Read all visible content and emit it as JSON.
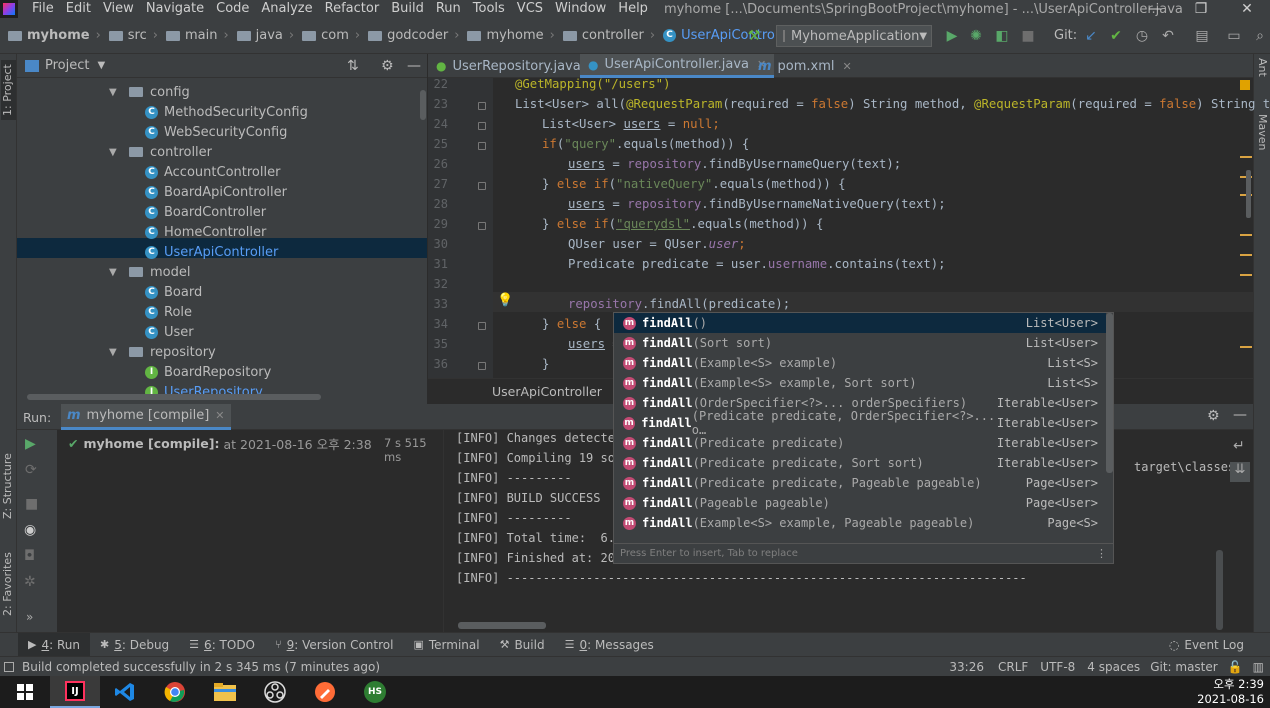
{
  "window": {
    "title": "myhome [...\\Documents\\SpringBootProject\\myhome] - ...\\UserApiController.java",
    "controls": [
      "—",
      "❐",
      "✕"
    ]
  },
  "menu": [
    "File",
    "Edit",
    "View",
    "Navigate",
    "Code",
    "Analyze",
    "Refactor",
    "Build",
    "Run",
    "Tools",
    "VCS",
    "Window",
    "Help"
  ],
  "breadcrumb": [
    "myhome",
    "src",
    "main",
    "java",
    "com",
    "godcoder",
    "myhome",
    "controller",
    "UserApiController"
  ],
  "run_config": "MyhomeApplication",
  "git_label": "Git:",
  "project_panel": {
    "title": "Project",
    "tree": [
      {
        "label": "config",
        "type": "folder",
        "open": true,
        "level": 1
      },
      {
        "label": "MethodSecurityConfig",
        "type": "class",
        "level": 2
      },
      {
        "label": "WebSecurityConfig",
        "type": "class",
        "level": 2
      },
      {
        "label": "controller",
        "type": "folder",
        "open": true,
        "level": 1
      },
      {
        "label": "AccountController",
        "type": "class",
        "level": 2
      },
      {
        "label": "BoardApiController",
        "type": "class",
        "level": 2
      },
      {
        "label": "BoardController",
        "type": "class",
        "level": 2
      },
      {
        "label": "HomeController",
        "type": "class",
        "level": 2
      },
      {
        "label": "UserApiController",
        "type": "class",
        "level": 2,
        "selected": true
      },
      {
        "label": "model",
        "type": "folder",
        "open": true,
        "level": 1
      },
      {
        "label": "Board",
        "type": "class",
        "level": 2
      },
      {
        "label": "Role",
        "type": "class",
        "level": 2
      },
      {
        "label": "User",
        "type": "class",
        "level": 2
      },
      {
        "label": "repository",
        "type": "folder",
        "open": true,
        "level": 1
      },
      {
        "label": "BoardRepository",
        "type": "interface",
        "level": 2
      },
      {
        "label": "UserRepository",
        "type": "interface",
        "level": 2
      }
    ]
  },
  "editor_tabs": [
    {
      "label": "UserRepository.java",
      "active": false
    },
    {
      "label": "UserApiController.java",
      "active": true
    },
    {
      "label": "pom.xml",
      "active": false
    }
  ],
  "code_lines": [
    {
      "n": "22"
    },
    {
      "n": "23"
    },
    {
      "n": "24"
    },
    {
      "n": "25"
    },
    {
      "n": "26"
    },
    {
      "n": "27"
    },
    {
      "n": "28"
    },
    {
      "n": "29"
    },
    {
      "n": "30"
    },
    {
      "n": "31"
    },
    {
      "n": "32"
    },
    {
      "n": "33"
    },
    {
      "n": "34"
    },
    {
      "n": "35"
    },
    {
      "n": "36"
    }
  ],
  "code": {
    "l22": "@GetMapping(\"/users\")",
    "l23a": "List<User> all(",
    "l23b": "@RequestParam",
    "l23c": "(required = ",
    "l23d": "false",
    "l23e": ") String method, ",
    "l23f": "@RequestParam",
    "l23g": "(required = ",
    "l23h": "false",
    "l23i": ") String text) {",
    "l24a": "List<User> ",
    "l24b": "users",
    "l24c": " = ",
    "l24d": "null",
    "l24e": ";",
    "l25a": "if",
    "l25b": "(",
    "l25c": "\"query\"",
    "l25d": ".equals(method)) {",
    "l26a": "users",
    "l26b": " = ",
    "l26c": "repository",
    "l26d": ".findByUsernameQuery(text);",
    "l27a": "} ",
    "l27b": "else if",
    "l27c": "(",
    "l27d": "\"nativeQuery\"",
    "l27e": ".equals(method)) {",
    "l28a": "users",
    "l28b": " = ",
    "l28c": "repository",
    "l28d": ".findByUsernameNativeQuery(text);",
    "l29a": "} ",
    "l29b": "else if",
    "l29c": "(",
    "l29d": "\"querydsl\"",
    "l29e": ".equals(method)) {",
    "l30a": "QUser user = QUser.",
    "l30b": "user",
    "l30c": ";",
    "l31a": "Predicate predicate = user.",
    "l31b": "username",
    "l31c": ".contains(text);",
    "l33a": "repository",
    "l33b": ".findAll(predicate);",
    "l34a": "} ",
    "l34b": "else",
    "l34c": " {",
    "l35a": "users",
    "l35b": " = ",
    "l36": "}"
  },
  "editor_breadcrumb": "UserApiController",
  "completion": {
    "items": [
      {
        "name": "findAll",
        "params": "()",
        "ret": "List<User>"
      },
      {
        "name": "findAll",
        "params": "(Sort sort)",
        "ret": "List<User>"
      },
      {
        "name": "findAll",
        "params": "(Example<S> example)",
        "ret": "List<S>"
      },
      {
        "name": "findAll",
        "params": "(Example<S> example, Sort sort)",
        "ret": "List<S>"
      },
      {
        "name": "findAll",
        "params": "(OrderSpecifier<?>... orderSpecifiers)",
        "ret": "Iterable<User>"
      },
      {
        "name": "findAll",
        "params": "(Predicate predicate, OrderSpecifier<?>... o…",
        "ret": "Iterable<User>"
      },
      {
        "name": "findAll",
        "params": "(Predicate predicate)",
        "ret": "Iterable<User>"
      },
      {
        "name": "findAll",
        "params": "(Predicate predicate, Sort sort)",
        "ret": "Iterable<User>"
      },
      {
        "name": "findAll",
        "params": "(Predicate predicate, Pageable pageable)",
        "ret": "Page<User>"
      },
      {
        "name": "findAll",
        "params": "(Pageable pageable)",
        "ret": "Page<User>"
      },
      {
        "name": "findAll",
        "params": "(Example<S> example, Pageable pageable)",
        "ret": "Page<S>"
      }
    ],
    "hint": "Press Enter to insert, Tab to replace"
  },
  "run_panel": {
    "label": "Run:",
    "tab": "myhome [compile]",
    "task": "myhome [compile]:",
    "task_time": "at 2021-08-16 오후 2:38",
    "duration": "7 s 515 ms",
    "console": [
      "[INFO] Changes detected",
      "[INFO] Compiling 19 sour",
      "[INFO] ---------",
      "[INFO] BUILD SUCCESS",
      "[INFO] ---------",
      "[INFO] Total time:  6.25",
      "[INFO] Finished at: 2021-08-16T14:38:23+09:00",
      "[INFO] ------------------------------------------------------------------------"
    ],
    "console_right": "target\\classes"
  },
  "bottom_tabs": [
    {
      "key": "4",
      "label": ": Run",
      "active": true,
      "icon": "▶"
    },
    {
      "key": "5",
      "label": ": Debug",
      "active": false,
      "icon": "✱"
    },
    {
      "key": "6",
      "label": ": TODO",
      "active": false,
      "icon": "☰"
    },
    {
      "key": "9",
      "label": ": Version Control",
      "active": false,
      "icon": "⑂"
    },
    {
      "key": "",
      "label": "Terminal",
      "active": false,
      "icon": "▣"
    },
    {
      "key": "",
      "label": "Build",
      "active": false,
      "icon": "⚒"
    },
    {
      "key": "0",
      "label": ": Messages",
      "active": false,
      "icon": "☰"
    }
  ],
  "event_log": "Event Log",
  "status": {
    "message": "Build completed successfully in 2 s 345 ms (7 minutes ago)",
    "position": "33:26",
    "line_sep": "CRLF",
    "encoding": "UTF-8",
    "indent": "4 spaces",
    "git": "Git: master"
  },
  "side_labels": {
    "project": "1: Project",
    "structure": "Z: Structure",
    "favorites": "2: Favorites",
    "ant": "Ant",
    "maven": "Maven"
  },
  "taskbar": {
    "time": "오후 2:39",
    "date": "2021-08-16"
  }
}
